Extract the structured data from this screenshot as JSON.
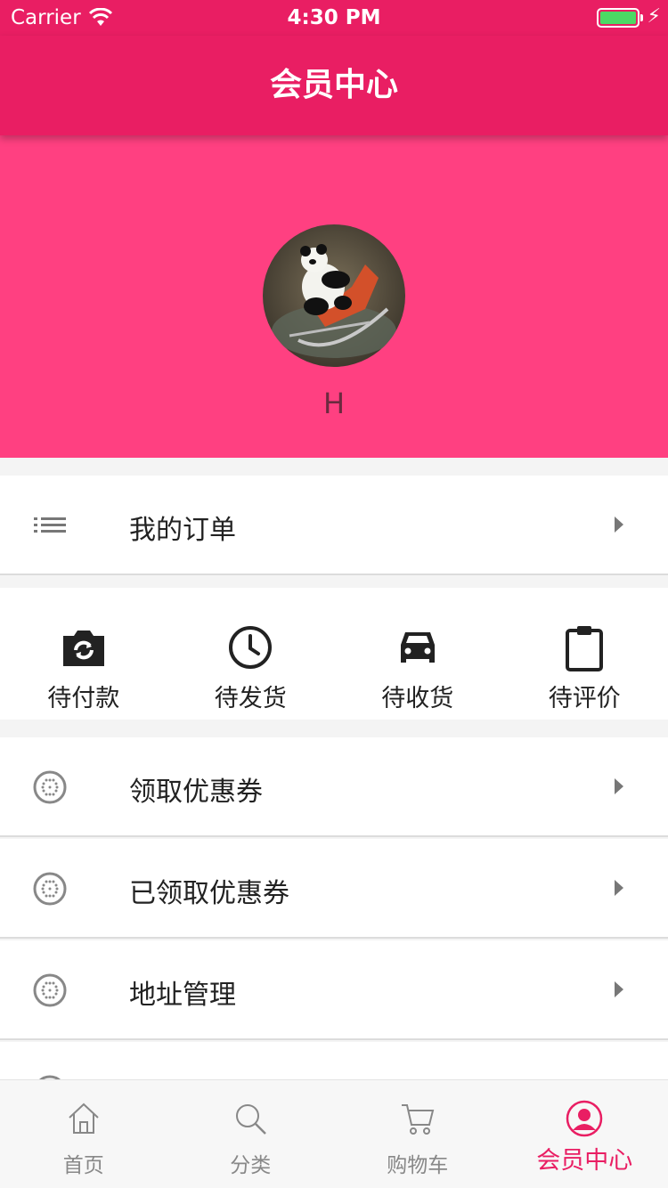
{
  "status_bar": {
    "carrier": "Carrier",
    "time": "4:30 PM"
  },
  "nav": {
    "title": "会员中心"
  },
  "profile": {
    "username": "H"
  },
  "orders": {
    "label": "我的订单"
  },
  "order_status": [
    {
      "label": "待付款",
      "icon": "camera-refresh-icon"
    },
    {
      "label": "待发货",
      "icon": "clock-icon"
    },
    {
      "label": "待收货",
      "icon": "car-icon"
    },
    {
      "label": "待评价",
      "icon": "clipboard-icon"
    }
  ],
  "menu": [
    {
      "label": "领取优惠券",
      "icon": "dial-icon"
    },
    {
      "label": "已领取优惠券",
      "icon": "dial-icon"
    },
    {
      "label": "地址管理",
      "icon": "dial-icon"
    }
  ],
  "tabs": [
    {
      "label": "首页",
      "icon": "home-icon"
    },
    {
      "label": "分类",
      "icon": "search-icon"
    },
    {
      "label": "购物车",
      "icon": "cart-icon"
    },
    {
      "label": "会员中心",
      "icon": "user-icon",
      "active": true
    }
  ],
  "colors": {
    "primary": "#e91e63",
    "header_bg": "#ff4081",
    "active_tab": "#e91e63"
  }
}
